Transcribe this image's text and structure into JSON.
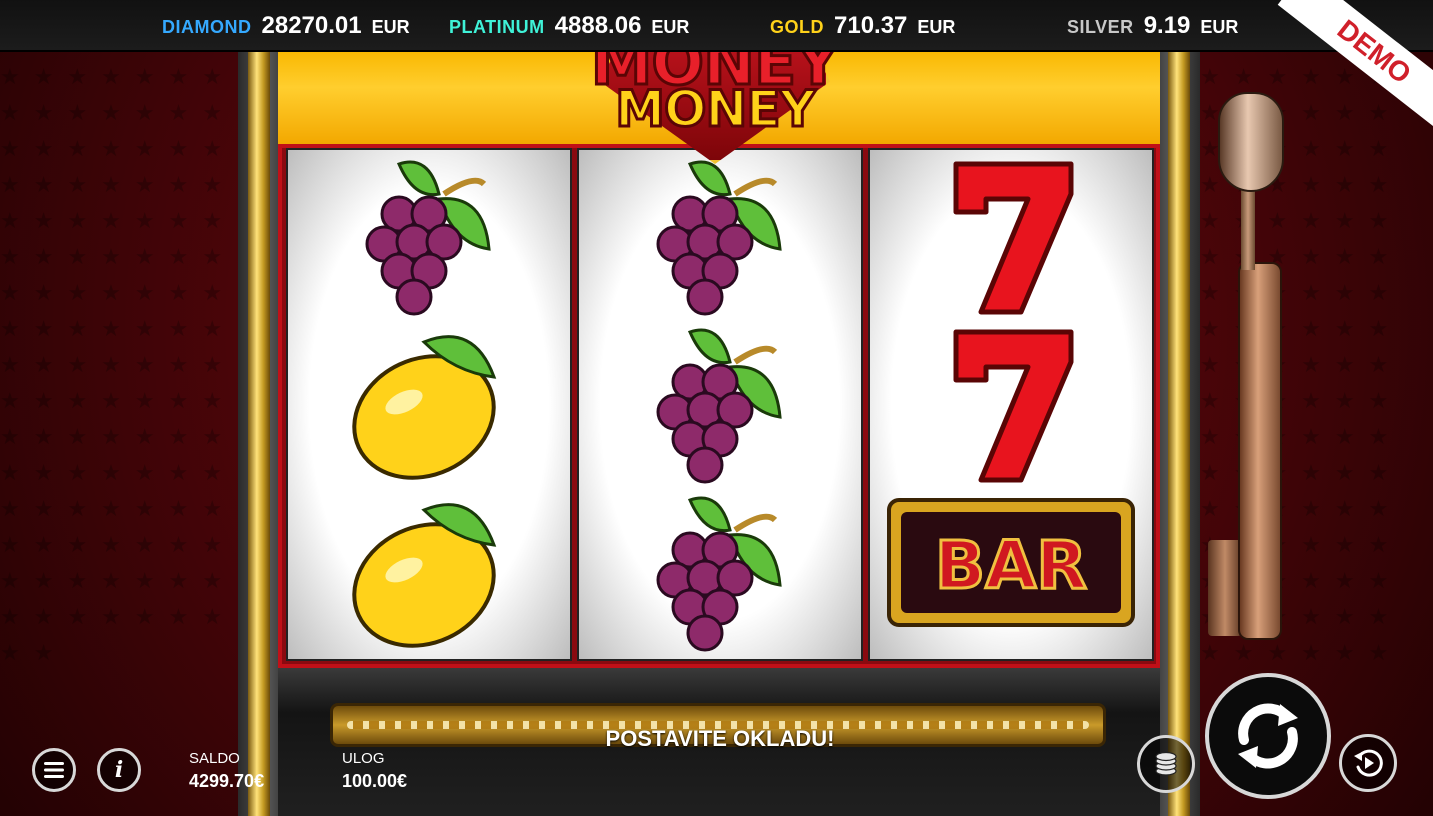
{
  "jackpots": [
    {
      "label": "DIAMOND",
      "value": "28270.01",
      "currency": "EUR",
      "color": "#35a9ff"
    },
    {
      "label": "PLATINUM",
      "value": "4888.06",
      "currency": "EUR",
      "color": "#3ff2d8"
    },
    {
      "label": "GOLD",
      "value": "710.37",
      "currency": "EUR",
      "color": "#ffd21a"
    },
    {
      "label": "SILVER",
      "value": "9.19",
      "currency": "EUR",
      "color": "#c8c8c8"
    }
  ],
  "demo_badge": "DEMO",
  "logo": {
    "line1": "MONEY",
    "line2": "MONEY"
  },
  "reels": [
    {
      "symbols": [
        "grapes",
        "lemon",
        "lemon"
      ]
    },
    {
      "symbols": [
        "grapes",
        "grapes",
        "grapes"
      ]
    },
    {
      "symbols": [
        "seven",
        "seven",
        "bar"
      ]
    }
  ],
  "bar_symbol_text": "BAR",
  "message": "POSTAVITE OKLADU!",
  "hud": {
    "saldo_label": "SALDO",
    "saldo_value": "4299.70€",
    "ulog_label": "ULOG",
    "ulog_value": "100.00€"
  },
  "icons": {
    "menu": "hamburger-icon",
    "info": "info-icon",
    "coins": "coin-stack-icon",
    "spin": "spin-arrows-icon",
    "autoplay": "autoplay-icon"
  },
  "colors": {
    "accent_red": "#c01018",
    "panel_gold": "#ffce2e"
  }
}
